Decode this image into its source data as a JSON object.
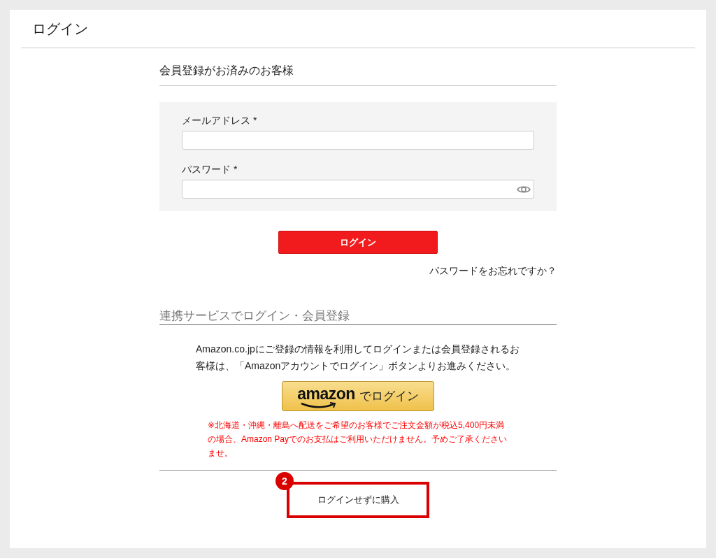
{
  "page_title": "ログイン",
  "member_section": {
    "heading": "会員登録がお済みのお客様",
    "fields": [
      {
        "label": "メールアドレス",
        "required_mark": "*",
        "kind": "text"
      },
      {
        "label": "パスワード",
        "required_mark": "*",
        "kind": "password"
      }
    ],
    "login_button": "ログイン",
    "forgot_link": "パスワードをお忘れですか？"
  },
  "social_section": {
    "heading": "連携サービスでログイン・会員登録",
    "description": "Amazon.co.jpにご登録の情報を利用してログインまたは会員登録されるお客様は、「Amazonアカウントでログイン」ボタンよりお進みください。",
    "amazon_button": {
      "logo": "amazon",
      "label": "でログイン"
    },
    "notice": "※北海道・沖縄・離島へ配送をご希望のお客様でご注文金額が税込5,400円未満の場合、Amazon Payでのお支払はご利用いただけません。予めご了承くださいませ。"
  },
  "guest_button": {
    "label": "ログインせずに購入",
    "highlighted": true,
    "badge": "2"
  }
}
